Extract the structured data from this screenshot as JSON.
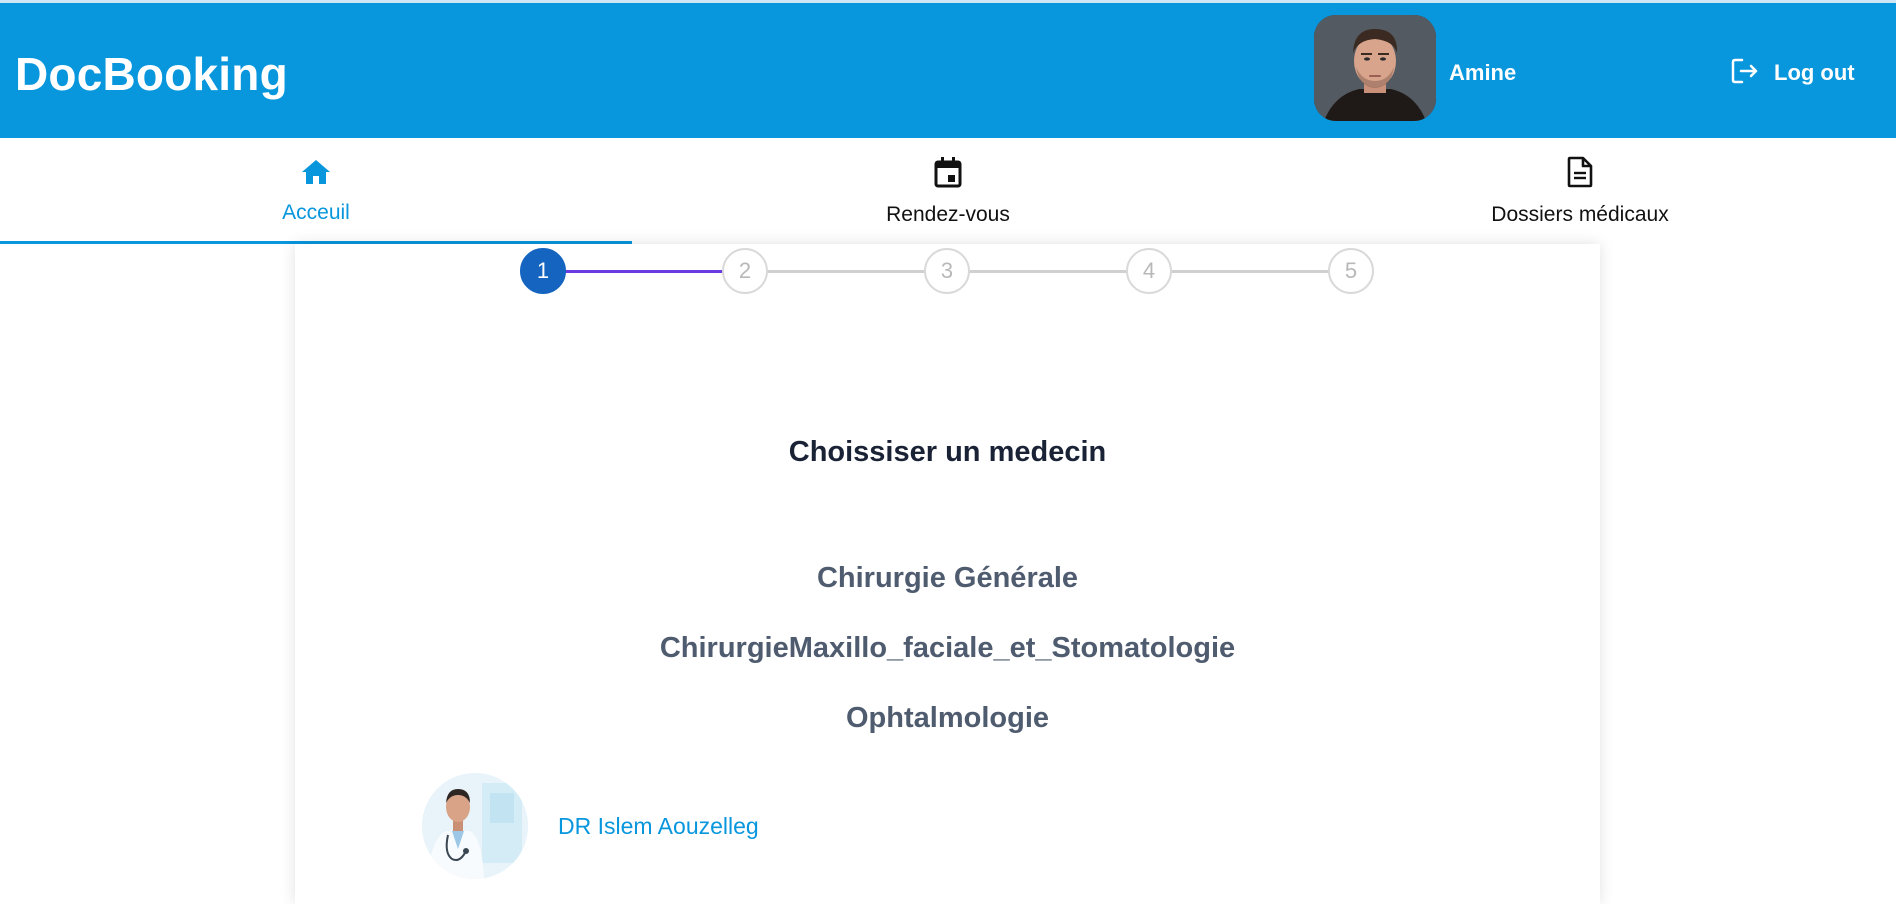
{
  "app": {
    "brand": "DocBooking"
  },
  "header": {
    "user_name": "Amine",
    "logout_label": "Log out"
  },
  "tabs": [
    {
      "label": "Acceuil",
      "icon": "home-icon",
      "active": true
    },
    {
      "label": "Rendez-vous",
      "icon": "calendar-icon",
      "active": false
    },
    {
      "label": "Dossiers médicaux",
      "icon": "document-icon",
      "active": false
    }
  ],
  "stepper": {
    "steps": [
      "1",
      "2",
      "3",
      "4",
      "5"
    ],
    "current_step": 1
  },
  "main": {
    "title": "Choissiser un medecin",
    "specialties": [
      "Chirurgie Générale",
      "ChirurgieMaxillo_faciale_et_Stomatologie",
      "Ophtalmologie"
    ],
    "doctors": [
      {
        "name": "DR Islem Aouzelleg"
      }
    ]
  },
  "colors": {
    "primary": "#0896dd",
    "step_active": "#1565c0",
    "progress_line": "#6a3be0",
    "title_text": "#1a2236",
    "specialty_text": "#4f5b6e"
  }
}
